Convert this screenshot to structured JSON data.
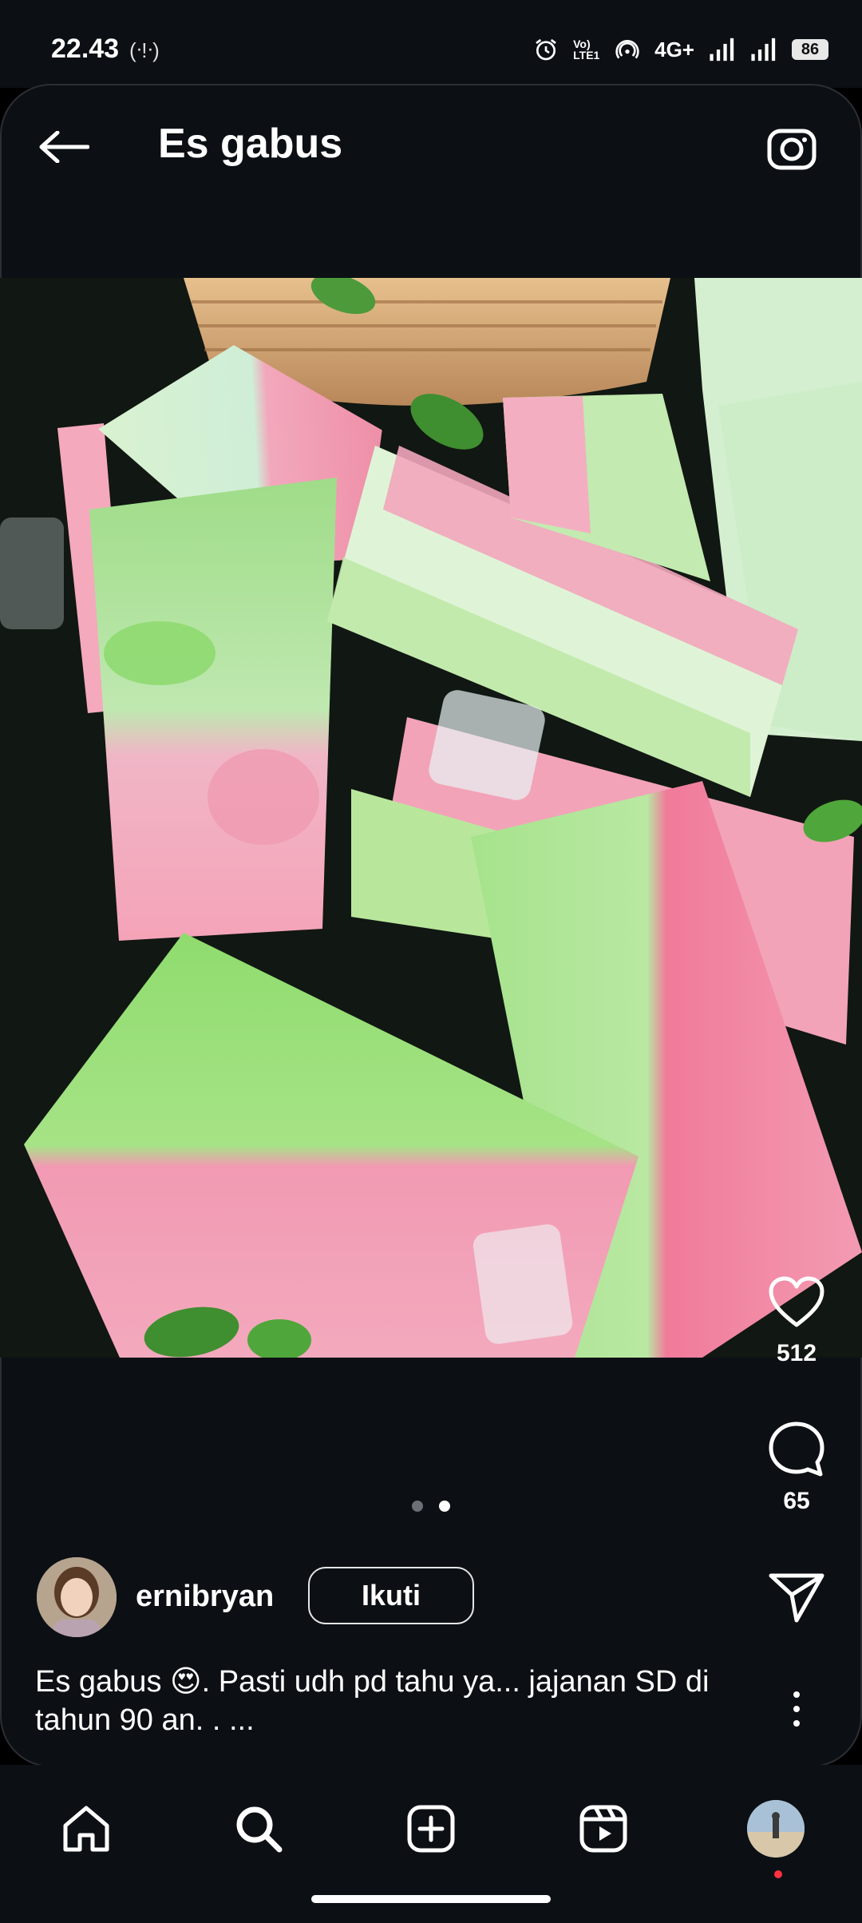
{
  "status_bar": {
    "time": "22.43",
    "recording_indicator": "(ᐧ!ᐧ)",
    "network_label": "4G+",
    "volte_label": "Vo) LTE1",
    "battery": "86"
  },
  "header": {
    "title": "Es gabus",
    "back_icon": "arrow-left-icon",
    "camera_icon": "camera-icon"
  },
  "post": {
    "carousel": {
      "total": 2,
      "current": 2
    },
    "likes": "512",
    "comments": "65",
    "author": "ernibryan",
    "follow_label": "Ikuti",
    "caption": "Es gabus 😍. Pasti udh pd tahu ya... jajanan SD di tahun 90 an. . ..."
  },
  "nav": {
    "items": [
      "home-icon",
      "search-icon",
      "create-icon",
      "reels-icon",
      "profile-avatar"
    ]
  },
  "colors": {
    "background": "#0c1014",
    "notification": "#ff3040"
  }
}
